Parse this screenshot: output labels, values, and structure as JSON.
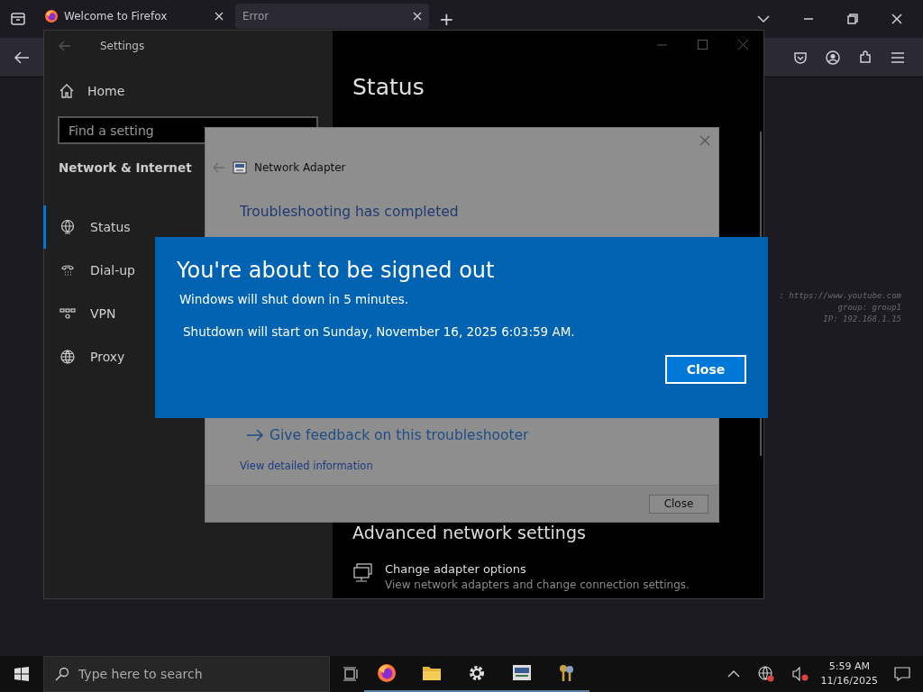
{
  "browser": {
    "tabs": [
      {
        "label": "Welcome to Firefox",
        "selected": false,
        "kind": "firefox"
      },
      {
        "label": "Error",
        "selected": true,
        "kind": "plain"
      }
    ],
    "new_tab": "+"
  },
  "background_text": [
    ": https://www.youtube.com",
    "group: group1",
    "IP: 192.168.1.15"
  ],
  "settings_window": {
    "title": "Settings",
    "home": "Home",
    "search": {
      "placeholder": "Find a setting"
    },
    "section": "Network & Internet",
    "nav": [
      {
        "label": "Status",
        "selected": true
      },
      {
        "label": "Dial-up",
        "selected": false
      },
      {
        "label": "VPN",
        "selected": false
      },
      {
        "label": "Proxy",
        "selected": false
      }
    ],
    "heading": "Status",
    "advanced_heading": "Advanced network settings",
    "option": {
      "title": "Change adapter options",
      "description": "View network adapters and change connection settings."
    }
  },
  "troubleshooter": {
    "title": "Network Adapter",
    "heading": "Troubleshooting has completed",
    "feedback_link": "Give feedback on this troubleshooter",
    "details_link": "View detailed information",
    "close_button": "Close"
  },
  "signout_dialog": {
    "title": "You're about to be signed out",
    "message": "Windows will shut down in 5 minutes.",
    "detail": "Shutdown will start on Sunday, November 16, 2025 6:03:59 AM.",
    "button": "Close"
  },
  "taskbar": {
    "search": {
      "placeholder": "Type here to search"
    },
    "time": "5:59 AM",
    "date": "11/16/2025"
  }
}
